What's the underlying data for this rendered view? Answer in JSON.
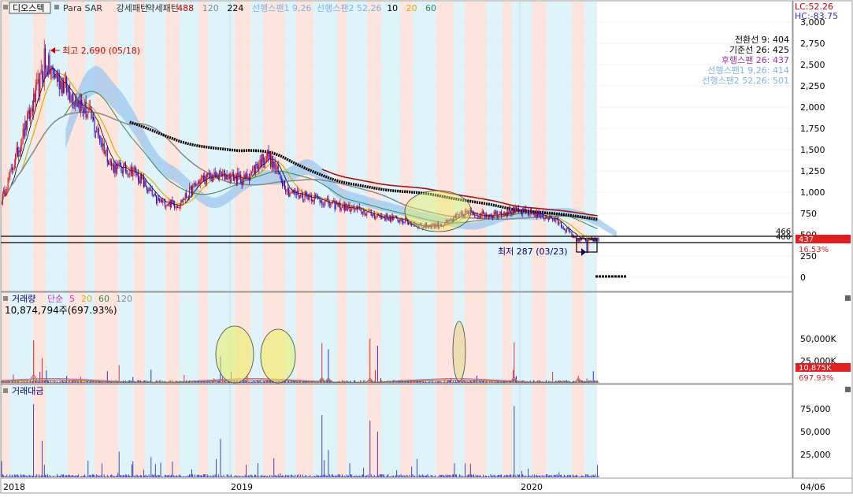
{
  "header": {
    "stock_name": "디오스텍",
    "indicators": [
      {
        "label": "Para SAR",
        "color": "#333333"
      },
      {
        "label": "강세패턴",
        "color": "#333333"
      },
      {
        "label": "약세패턴",
        "color": "#333333"
      },
      {
        "label": "488",
        "color": "#cc0000"
      },
      {
        "label": "120",
        "color": "#888888"
      },
      {
        "label": "224",
        "color": "#000000"
      },
      {
        "label": "선행스팬1 9,26",
        "color": "#7fb2e5"
      },
      {
        "label": "선행스팬2 52,26",
        "color": "#7fb2e5"
      },
      {
        "label": "10",
        "color": "#000000"
      },
      {
        "label": "20",
        "color": "#e6a800"
      },
      {
        "label": "60",
        "color": "#2e8b57"
      }
    ]
  },
  "lc_label": "LC:52.26",
  "hc_label": "HC:-83.75",
  "ichimoku_legend": [
    {
      "label": "전환선 9: 404",
      "color": "#000000"
    },
    {
      "label": "기준선 26: 425",
      "color": "#000000"
    },
    {
      "label": "후행스팬 26: 437",
      "color": "#a030a0"
    },
    {
      "label": "선행스팬1 9,26: 414",
      "color": "#7fb2e5"
    },
    {
      "label": "선행스팬2 52,26: 501",
      "color": "#7fb2e5"
    }
  ],
  "annotations": {
    "high_label": "최고 2,690 (05/18)",
    "low_label": "최저 287 (03/23)",
    "line_466": "466",
    "line_400": "400",
    "current_price": "437",
    "current_pct": "16.53%",
    "volume_current": "10,875K",
    "volume_pct": "697.93%"
  },
  "volume_panel": {
    "title": "거래량",
    "ma_label": "단순",
    "ma_periods": [
      {
        "label": "5",
        "color": "#cc33cc"
      },
      {
        "label": "20",
        "color": "#e6a800"
      },
      {
        "label": "60",
        "color": "#2e8b57"
      },
      {
        "label": "120",
        "color": "#888888"
      }
    ],
    "info": "10,874,794주(697.93%)"
  },
  "amount_panel": {
    "title": "거래대금"
  },
  "date_labels": {
    "bottom_right": "04/06"
  },
  "chart_data": [
    {
      "type": "candlestick",
      "title": "디오스텍",
      "x_labels": [
        "2018",
        "2019",
        "2020"
      ],
      "y_ticks": [
        "0",
        "250",
        "500",
        "750",
        "1,000",
        "1,250",
        "1,500",
        "1,750",
        "2,000",
        "2,250",
        "2,500",
        "2,750",
        "3,000"
      ],
      "ylim": [
        0,
        3000
      ],
      "high": {
        "value": 2690,
        "date": "05/18"
      },
      "low": {
        "value": 287,
        "date": "03/23"
      },
      "close_series": {
        "name": "close",
        "x": [
          "2018-01",
          "2018-02",
          "2018-03",
          "2018-04",
          "2018-05",
          "2018-06",
          "2018-07",
          "2018-08",
          "2018-09",
          "2018-10",
          "2018-11",
          "2018-12",
          "2019-01",
          "2019-02",
          "2019-03",
          "2019-04",
          "2019-05",
          "2019-06",
          "2019-07",
          "2019-08",
          "2019-09",
          "2019-10",
          "2019-11",
          "2019-12",
          "2020-01",
          "2020-02",
          "2020-03",
          "2020-04"
        ],
        "values": [
          900,
          1700,
          2500,
          2200,
          1900,
          1300,
          1250,
          900,
          850,
          1150,
          1200,
          1150,
          1450,
          1000,
          950,
          850,
          800,
          720,
          680,
          600,
          620,
          760,
          730,
          780,
          760,
          680,
          450,
          437
        ]
      },
      "horizontal_lines": [
        466,
        400
      ]
    },
    {
      "type": "bar",
      "title": "거래량",
      "y_ticks": [
        "25,000K",
        "50,000K"
      ],
      "ylim": [
        0,
        60000
      ],
      "current": 10875
    },
    {
      "type": "bar",
      "title": "거래대금",
      "y_ticks": [
        "25,000",
        "50,000",
        "75,000"
      ],
      "ylim": [
        0,
        90000
      ]
    }
  ]
}
